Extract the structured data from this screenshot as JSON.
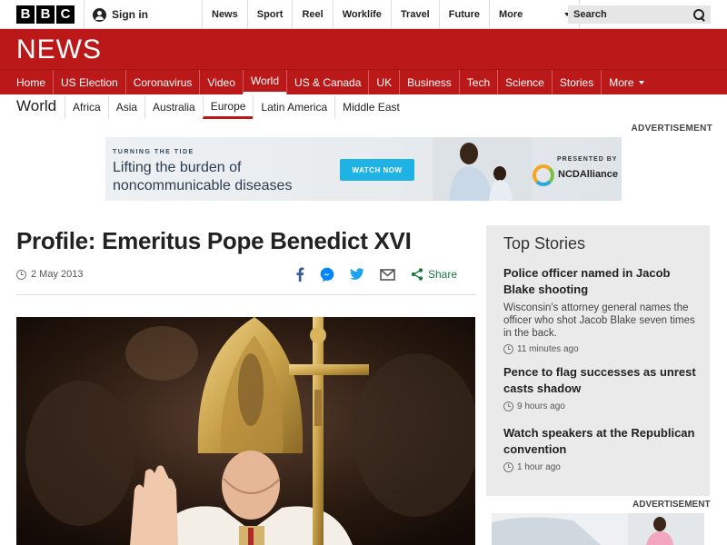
{
  "topbar": {
    "logo_letters": [
      "B",
      "B",
      "C"
    ],
    "signin": "Sign in",
    "nav": [
      "News",
      "Sport",
      "Reel",
      "Worklife",
      "Travel",
      "Future"
    ],
    "more": "More",
    "search_placeholder": "Search"
  },
  "news_banner": {
    "logo": "NEWS"
  },
  "main_nav": {
    "items": [
      "Home",
      "US Election",
      "Coronavirus",
      "Video",
      "World",
      "US & Canada",
      "UK",
      "Business",
      "Tech",
      "Science",
      "Stories"
    ],
    "more": "More",
    "active": "World"
  },
  "section_nav": {
    "title": "World",
    "items": [
      "Africa",
      "Asia",
      "Australia",
      "Europe",
      "Latin America",
      "Middle East"
    ],
    "active": "Europe"
  },
  "advert": {
    "label": "ADVERTISEMENT",
    "kicker": "TURNING THE TIDE",
    "headline_line1": "Lifting the burden of",
    "headline_line2": "noncommunicable diseases",
    "button": "WATCH NOW",
    "presented_by": "PRESENTED BY",
    "brand": "NCDAlliance"
  },
  "article": {
    "headline": "Profile: Emeritus Pope Benedict XVI",
    "date": "2 May 2013",
    "share_label": "Share",
    "share_icons": [
      "facebook-icon",
      "messenger-icon",
      "twitter-icon",
      "email-icon",
      "share-icon"
    ]
  },
  "top_stories": {
    "title": "Top Stories",
    "stories": [
      {
        "headline": "Police officer named in Jacob Blake shooting",
        "summary": "Wisconsin's attorney general names the officer who shot Jacob Blake seven times in the back.",
        "time": "11 minutes ago"
      },
      {
        "headline": "Pence to flag successes as unrest casts shadow",
        "summary": "",
        "time": "9 hours ago"
      },
      {
        "headline": "Watch speakers at the Republican convention",
        "summary": "",
        "time": "1 hour ago"
      }
    ]
  },
  "sidebar_advert": {
    "label": "ADVERTISEMENT"
  },
  "colors": {
    "brand_red": "#bb1919",
    "share_green": "#1a7a3e",
    "icon_blue": "#3b5998"
  }
}
